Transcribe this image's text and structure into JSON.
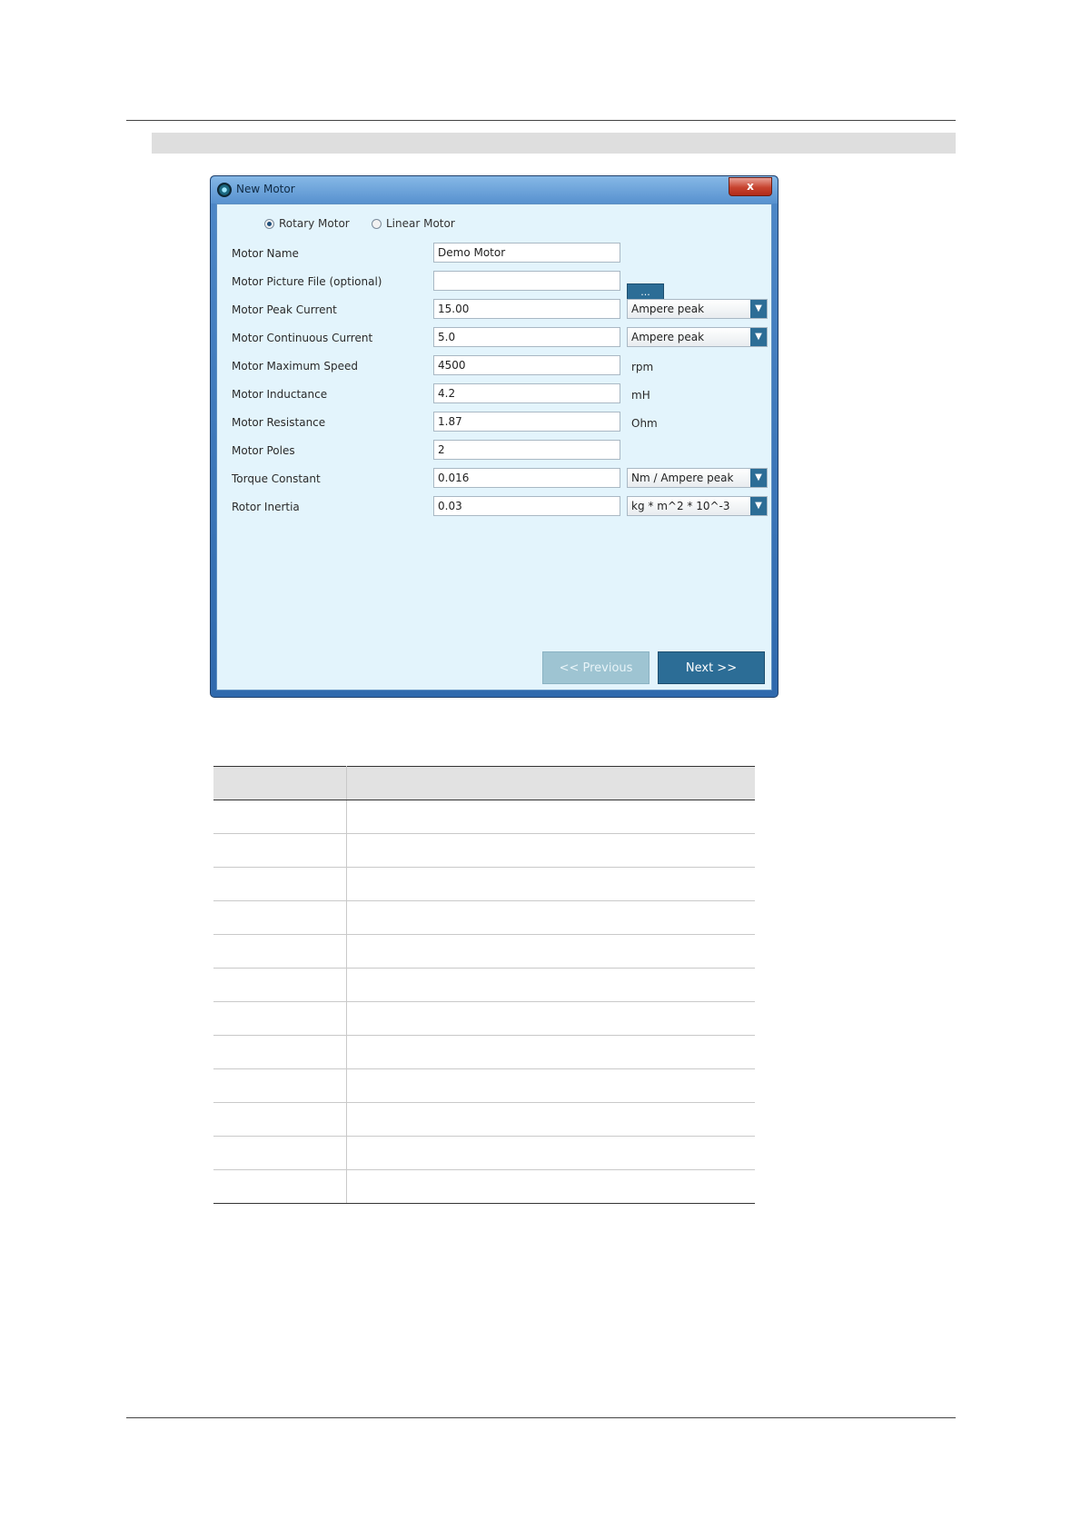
{
  "window": {
    "title": "New Motor",
    "close_label": "x"
  },
  "motor_type": {
    "rotary_label": "Rotary Motor",
    "linear_label": "Linear Motor",
    "selected": "Rotary Motor"
  },
  "fields": {
    "name": {
      "label": "Motor Name",
      "value": "Demo Motor"
    },
    "picture": {
      "label": "Motor Picture File (optional)",
      "value": "",
      "browse_label": "..."
    },
    "peak_current": {
      "label": "Motor Peak Current",
      "value": "15.00",
      "unit": "Ampere peak"
    },
    "continuous_current": {
      "label": "Motor Continuous Current",
      "value": "5.0",
      "unit": "Ampere peak"
    },
    "max_speed": {
      "label": "Motor Maximum Speed",
      "value": "4500",
      "unit": "rpm"
    },
    "inductance": {
      "label": "Motor Inductance",
      "value": "4.2",
      "unit": "mH"
    },
    "resistance": {
      "label": "Motor Resistance",
      "value": "1.87",
      "unit": "Ohm"
    },
    "poles": {
      "label": "Motor Poles",
      "value": "2"
    },
    "torque_constant": {
      "label": "Torque Constant",
      "value": "0.016",
      "unit": "Nm / Ampere peak"
    },
    "rotor_inertia": {
      "label": "Rotor Inertia",
      "value": "0.03",
      "unit": "kg * m^2 * 10^-3"
    }
  },
  "buttons": {
    "previous_label": "<< Previous",
    "next_label": "Next >>"
  },
  "icons": {
    "app": "app-logo-icon",
    "dropdown": "chevron-down-icon"
  },
  "colors": {
    "client_bg": "#e3f4fc",
    "accent": "#2c6d96",
    "disabled_button": "#9ec4d2"
  }
}
